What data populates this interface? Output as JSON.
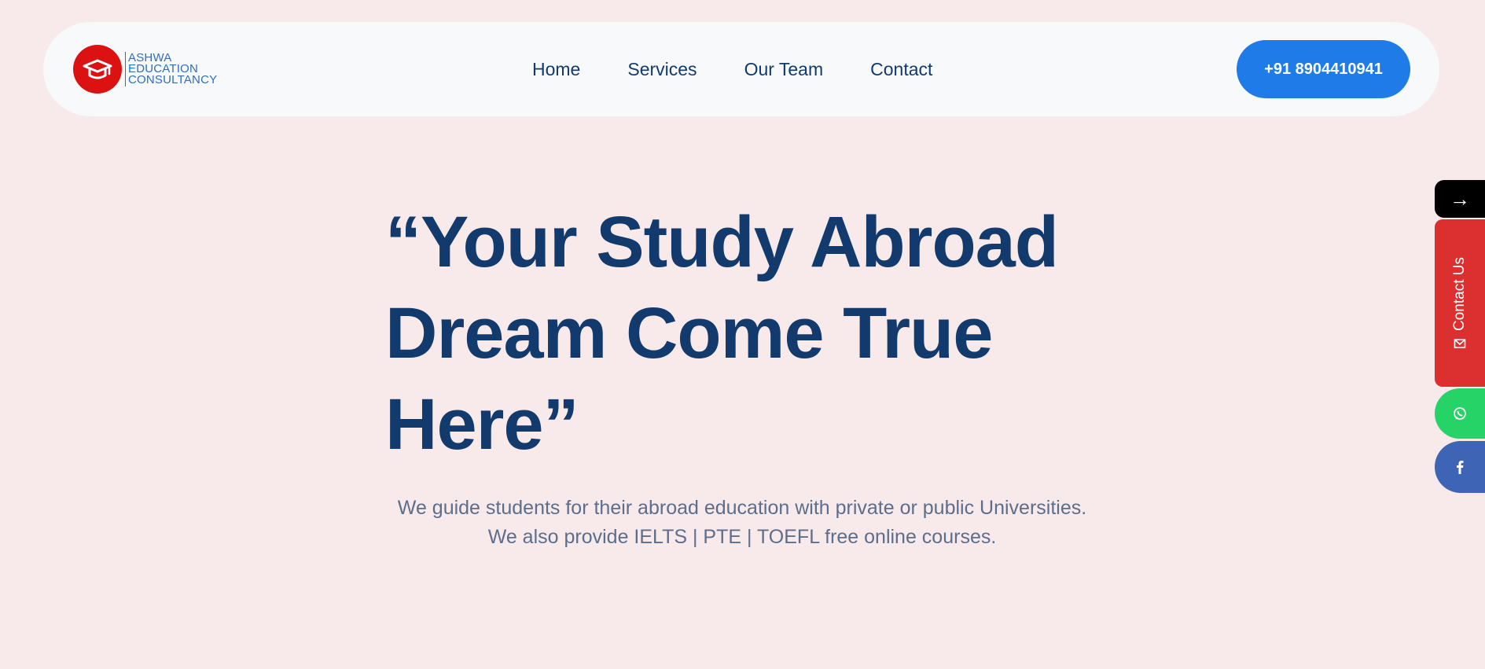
{
  "header": {
    "logo": {
      "line1": "ASHWA",
      "line2": "EDUCATION",
      "line3": "CONSULTANCY",
      "icon": "graduation-cap-icon",
      "badge_color": "#dc1212"
    },
    "nav": {
      "items": [
        {
          "label": "Home"
        },
        {
          "label": "Services"
        },
        {
          "label": "Our Team"
        },
        {
          "label": "Contact"
        }
      ]
    },
    "phone_button": {
      "label": "+91 8904410941",
      "color": "#1e7be8"
    }
  },
  "hero": {
    "title": "“Your Study Abroad Dream Come True Here”",
    "subtitle": "We guide students for their abroad education with private or public Universities. We also provide IELTS | PTE | TOEFL free online courses."
  },
  "side_widgets": {
    "toggle_icon": "→",
    "contact_label": "Contact Us",
    "contact_icon": "envelope-icon",
    "contact_color": "#dc3030",
    "whatsapp_icon": "whatsapp-icon",
    "whatsapp_color": "#25d366",
    "facebook_icon": "facebook-icon",
    "facebook_color": "#3e64b5"
  },
  "colors": {
    "background": "#f8eaea",
    "header_bg": "#f7f9fb",
    "heading": "#123a6d",
    "body_text": "#5b6e8c"
  }
}
